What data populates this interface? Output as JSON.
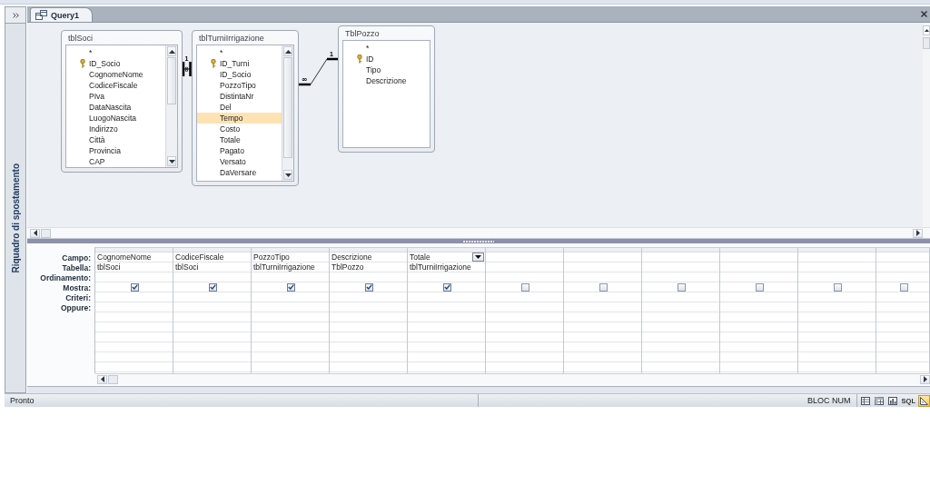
{
  "navigation_pane": {
    "title": "Riquadro di spostamento"
  },
  "tabs": [
    {
      "label": "Query1",
      "selected": true
    }
  ],
  "tables": [
    {
      "name": "tblSoci",
      "scrollable": true,
      "fields": [
        {
          "name": "*",
          "key": false,
          "selected": false
        },
        {
          "name": "ID_Socio",
          "key": true,
          "selected": false
        },
        {
          "name": "CognomeNome",
          "key": false,
          "selected": false
        },
        {
          "name": "CodiceFiscale",
          "key": false,
          "selected": false
        },
        {
          "name": "PIva",
          "key": false,
          "selected": false
        },
        {
          "name": "DataNascita",
          "key": false,
          "selected": false
        },
        {
          "name": "LuogoNascita",
          "key": false,
          "selected": false
        },
        {
          "name": "Indirizzo",
          "key": false,
          "selected": false
        },
        {
          "name": "Città",
          "key": false,
          "selected": false
        },
        {
          "name": "Provincia",
          "key": false,
          "selected": false
        },
        {
          "name": "CAP",
          "key": false,
          "selected": false
        }
      ]
    },
    {
      "name": "tblTurniIrrigazione",
      "scrollable": true,
      "fields": [
        {
          "name": "*",
          "key": false,
          "selected": false
        },
        {
          "name": "ID_Turni",
          "key": true,
          "selected": false
        },
        {
          "name": "ID_Socio",
          "key": false,
          "selected": false
        },
        {
          "name": "PozzoTipo",
          "key": false,
          "selected": false
        },
        {
          "name": "DistintaNr",
          "key": false,
          "selected": false
        },
        {
          "name": "Del",
          "key": false,
          "selected": false
        },
        {
          "name": "Tempo",
          "key": false,
          "selected": true
        },
        {
          "name": "Costo",
          "key": false,
          "selected": false
        },
        {
          "name": "Totale",
          "key": false,
          "selected": false
        },
        {
          "name": "Pagato",
          "key": false,
          "selected": false
        },
        {
          "name": "Versato",
          "key": false,
          "selected": false
        },
        {
          "name": "DaVersare",
          "key": false,
          "selected": false
        }
      ]
    },
    {
      "name": "TblPozzo",
      "scrollable": false,
      "fields": [
        {
          "name": "*",
          "key": false,
          "selected": false
        },
        {
          "name": "ID",
          "key": true,
          "selected": false
        },
        {
          "name": "Tipo",
          "key": false,
          "selected": false
        },
        {
          "name": "Descrizione",
          "key": false,
          "selected": false
        }
      ]
    }
  ],
  "relationships": [
    {
      "one": "1",
      "many": "∞"
    },
    {
      "one": "1",
      "many": "∞"
    }
  ],
  "grid": {
    "row_labels": [
      "Campo:",
      "Tabella:",
      "Ordinamento:",
      "Mostra:",
      "Criteri:",
      "Oppure:"
    ],
    "columns": [
      {
        "field": "CognomeNome",
        "table": "tblSoci",
        "show": true,
        "selected": false
      },
      {
        "field": "CodiceFiscale",
        "table": "tblSoci",
        "show": true,
        "selected": false
      },
      {
        "field": "PozzoTipo",
        "table": "tblTurniIrrigazione",
        "show": true,
        "selected": false
      },
      {
        "field": "Descrizione",
        "table": "TblPozzo",
        "show": true,
        "selected": false
      },
      {
        "field": "Totale",
        "table": "tblTurniIrrigazione",
        "show": true,
        "selected": true
      },
      {
        "show": false,
        "selected": false
      },
      {
        "show": false,
        "selected": false
      },
      {
        "show": false,
        "selected": false
      },
      {
        "show": false,
        "selected": false
      },
      {
        "show": false,
        "selected": false
      },
      {
        "show": false,
        "selected": false
      }
    ]
  },
  "status_bar": {
    "text": "Pronto",
    "indicator": "BLOC NUM",
    "views": [
      {
        "kind": "datasheet",
        "selected": false
      },
      {
        "kind": "pivottable",
        "selected": false
      },
      {
        "kind": "pivotchart",
        "selected": false
      },
      {
        "kind": "sql",
        "label": "SQL",
        "selected": false
      },
      {
        "kind": "design",
        "selected": true
      }
    ]
  }
}
